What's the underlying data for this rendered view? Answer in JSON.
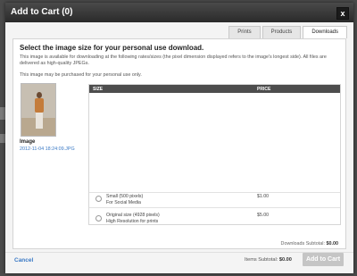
{
  "modal": {
    "title": "Add to Cart (0)",
    "close_label": "x"
  },
  "tabs": [
    {
      "label": "Prints"
    },
    {
      "label": "Products"
    },
    {
      "label": "Downloads",
      "active": true
    }
  ],
  "downloads": {
    "heading": "Select the image size for your personal use download.",
    "description": "This image is available for downloading at the following rates/sizes (the pixel dimension displayed refers to the image's longest side). All files are delivered as high-quality JPEGs.",
    "note": "This image may be purchased for your personal use only.",
    "image": {
      "label": "Image",
      "filename": "2012-11-04 18:24:09.JPG"
    },
    "table": {
      "headers": {
        "size": "SIZE",
        "price": "PRICE"
      },
      "options": [
        {
          "title": "Small (500 pixels)",
          "subtitle": "For Social Media",
          "price": "$1.00"
        },
        {
          "title": "Original size (4928 pixels)",
          "subtitle": "High Resolution for prints",
          "price": "$5.00"
        }
      ]
    },
    "subtotal_label": "Downloads Subtotal:",
    "subtotal_value": "$0.00"
  },
  "footer": {
    "cancel_label": "Cancel",
    "items_subtotal_label": "Items Subtotal:",
    "items_subtotal_value": "$0.00",
    "add_label": "Add to Cart"
  }
}
